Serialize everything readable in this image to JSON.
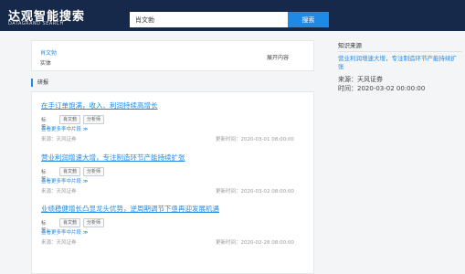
{
  "header": {
    "logo_main": "达观智能搜索",
    "logo_sub": "DATAGRAND SEARCH",
    "search_value": "肖文勃",
    "search_button": "搜索"
  },
  "entity": {
    "name": "肖文勃",
    "type": "实体",
    "expand": "展开内容"
  },
  "section_label": "研报",
  "results": [
    {
      "title": "在手订单饱满，收入、利润持续高增长",
      "tag_label": "标签：",
      "tags": [
        "肖文勃",
        "分析师"
      ],
      "more": "查看更多李中片段 ≫",
      "source": "来源：天风证券",
      "time": "更新时间：2020-03-01 08:00:00"
    },
    {
      "title": "营业利润增速大增，专注制造环节产能持续扩张",
      "tag_label": "标签：",
      "tags": [
        "肖文勃",
        "分析师"
      ],
      "more": "查看更多李中片段 ≫",
      "source": "来源：天风证券",
      "time": "更新时间：2020-03-02 08:00:00"
    },
    {
      "title": "业绩稳健增长凸显龙头优势，逆周期调节下亟再迎发展机遇",
      "tag_label": "标签：",
      "tags": [
        "肖文勃",
        "分析师"
      ],
      "more": "查看更多李中片段 ≫",
      "source": "来源：天风证券",
      "time": "更新时间：2020-02-28 08:00:00"
    }
  ],
  "knowledge": {
    "heading": "知识来源",
    "title": "营业利润增速大增，专注制造环节产能持续扩张",
    "source": "来源：天风证券",
    "time": "时间：2020-03-02 00:00:00"
  },
  "colors": {
    "topbar": "#17294b",
    "accent": "#1f8ae6",
    "background": "#f4f5f7"
  }
}
